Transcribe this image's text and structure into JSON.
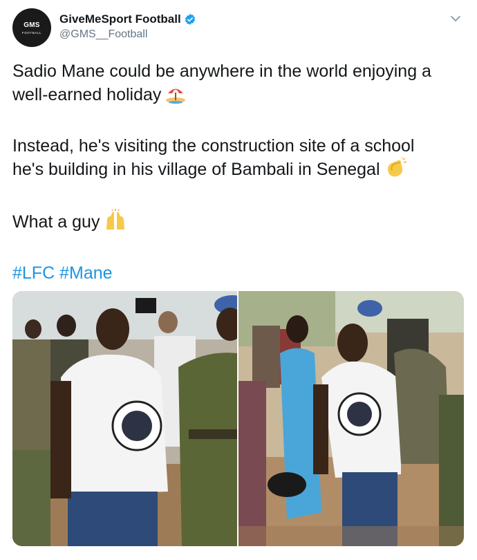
{
  "account": {
    "display_name": "GiveMeSport Football",
    "handle": "@GMS__Football",
    "avatar_text_top": "GMS",
    "avatar_text_bottom": "FOOTBALL",
    "verified": true
  },
  "tweet": {
    "line1": "Sadio Mane could be anywhere in the world enjoying a",
    "line2": "well-earned holiday",
    "line3": "Instead, he's visiting the construction site of a school",
    "line4": "he's building in his village of Bambali in Senegal",
    "line5": "What a guy",
    "hashtag1": "#LFC",
    "hashtag2": "#Mane"
  },
  "icons": {
    "holiday_emoji": "beach-umbrella-icon",
    "clap_emoji": "clapping-hands-icon",
    "raise_emoji": "raising-hands-icon",
    "menu": "chevron-down-icon",
    "verified": "verified-badge-icon"
  },
  "colors": {
    "accent": "#1b95e0",
    "text": "#14171a",
    "muted": "#657786"
  }
}
